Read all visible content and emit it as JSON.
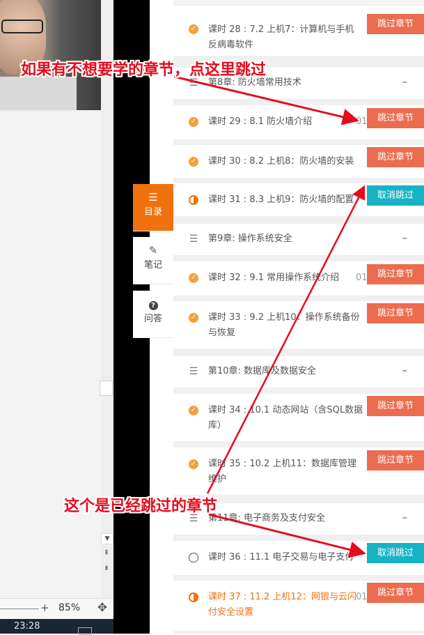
{
  "player": {
    "zoom_value": "85%",
    "zoom_plus": "+",
    "clock": "23:28"
  },
  "side_tabs": [
    {
      "label": "目录",
      "icon": "list-icon",
      "active": true
    },
    {
      "label": "笔记",
      "icon": "pencil-icon",
      "active": false
    },
    {
      "label": "问答",
      "icon": "question-icon",
      "active": false
    }
  ],
  "lessons": [
    {
      "kind": "lesson",
      "status": "done",
      "text": "课时 28 : 7.2 上机7：计算机与手机反病毒软件",
      "button": "跳过章节"
    },
    {
      "kind": "chapter",
      "text": "第8章: 防火墙常用技术",
      "collapse": "–"
    },
    {
      "kind": "lesson",
      "status": "done",
      "text": "课时 29 : 8.1 防火墙介绍",
      "duration": "01",
      "button": "跳过章节"
    },
    {
      "kind": "lesson",
      "status": "done",
      "text": "课时 30 : 8.2 上机8：防火墙的安装",
      "button": "跳过章节"
    },
    {
      "kind": "lesson",
      "status": "partial",
      "text": "课时 31 : 8.3 上机9：防火墙的配置",
      "button": "取消跳过"
    },
    {
      "kind": "chapter",
      "text": "第9章: 操作系统安全",
      "collapse": "–"
    },
    {
      "kind": "lesson",
      "status": "done",
      "text": "课时 32 : 9.1 常用操作系统介绍",
      "duration": "01",
      "button": "跳过章节"
    },
    {
      "kind": "lesson",
      "status": "done",
      "text": "课时 33 : 9.2 上机10：操作系统备份与恢复",
      "button": "跳过章节"
    },
    {
      "kind": "chapter",
      "text": "第10章: 数据库及数据安全",
      "collapse": "–"
    },
    {
      "kind": "lesson",
      "status": "done",
      "text": "课时 34 : 10.1 动态网站（含SQL数据库）",
      "button": "跳过章节"
    },
    {
      "kind": "lesson",
      "status": "done",
      "text": "课时 35 : 10.2 上机11：数据库管理维护",
      "button": "跳过章节"
    },
    {
      "kind": "chapter",
      "text": "第11章: 电子商务及支付安全",
      "collapse": "–"
    },
    {
      "kind": "lesson",
      "status": "none",
      "text": "课时 36 : 11.1 电子交易与电子支付",
      "button": "取消跳过"
    },
    {
      "kind": "lesson",
      "status": "current",
      "text": "课时 37 : 11.2 上机12：网银与云闪付安全设置",
      "duration": "01",
      "button": "跳过章节"
    }
  ],
  "annotations": {
    "top": "如果有不想要学的章节，点这里跳过",
    "bottom": "这个是已经跳过的章节"
  },
  "colors": {
    "accent": "#f2710f",
    "skip_button": "#eb6c4e",
    "undo_button": "#17b3c5",
    "annotation": "#e60b1c"
  }
}
